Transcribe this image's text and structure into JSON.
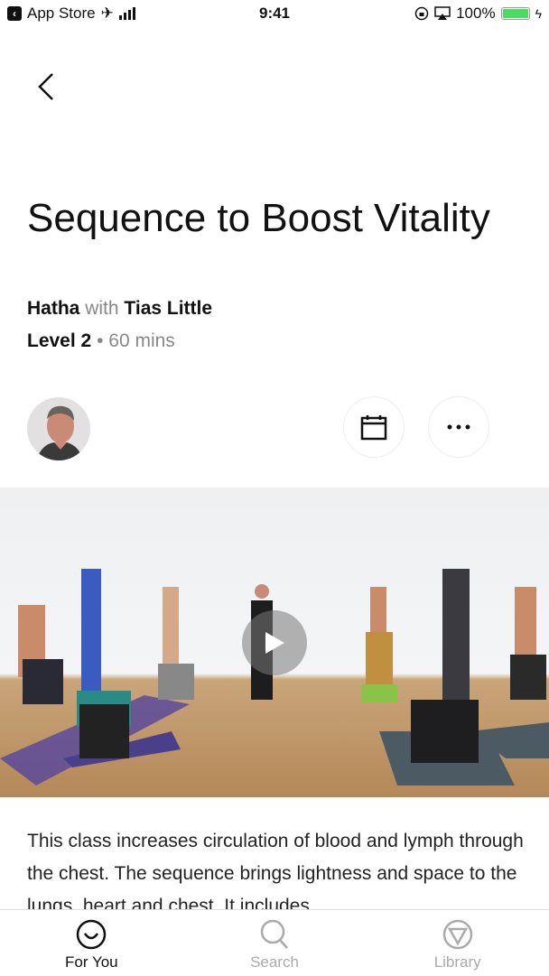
{
  "status_bar": {
    "back_app": "App Store",
    "time": "9:41",
    "battery": "100%",
    "battery_level": 1.0
  },
  "header": {
    "back_icon": "chevron-left-icon"
  },
  "class": {
    "title": "Sequence to Boost Vitality",
    "style": "Hatha",
    "with_word": "with",
    "teacher": "Tias Little",
    "level": "Level 2",
    "separator": "•",
    "duration": "60 mins"
  },
  "actions": {
    "avatar_icon": "teacher-avatar",
    "calendar_icon": "calendar-icon",
    "more_icon": "more-icon"
  },
  "video": {
    "play_icon": "play-icon"
  },
  "description": "This class increases circulation of blood and lymph through the chest. The sequence brings lightness and space to the lungs, heart and chest. It includes",
  "tabbar": {
    "tabs": [
      {
        "label": "For You",
        "icon": "smile-icon",
        "active": true
      },
      {
        "label": "Search",
        "icon": "search-icon",
        "active": false
      },
      {
        "label": "Library",
        "icon": "library-icon",
        "active": false
      }
    ]
  }
}
